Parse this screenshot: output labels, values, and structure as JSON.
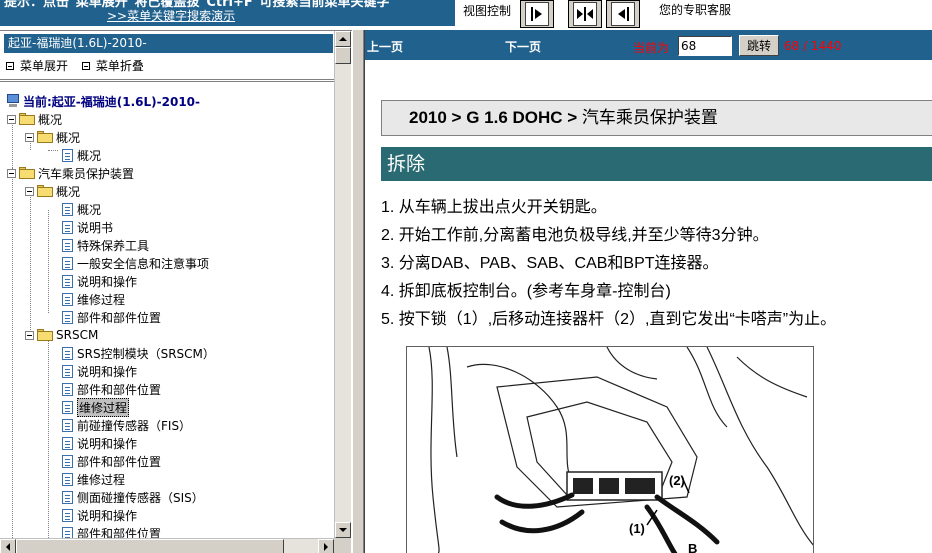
{
  "topbar": {
    "tip_text": "提示：点击\"菜单展开\"将已覆盖拔\"Ctrl+F\"可搜索当前菜单关键字",
    "tip_link": ">>菜单关键字搜索演示",
    "view_control_label": "视图控制",
    "support_text": "您的专职客服",
    "view_buttons": [
      "expand-right",
      "split",
      "expand-left"
    ]
  },
  "left_panel": {
    "model_title": "起亚-福瑞迪(1.6L)-2010-",
    "menu_expand": "菜单展开",
    "menu_collapse": "菜单折叠",
    "tree": {
      "root": "当前:起亚-福瑞迪(1.6L)-2010-",
      "items": [
        {
          "label": "概况",
          "type": "folder",
          "level": 0
        },
        {
          "label": "概况",
          "type": "folder",
          "level": 1
        },
        {
          "label": "概况",
          "type": "page",
          "level": 2
        },
        {
          "label": "汽车乘员保护装置",
          "type": "folder",
          "level": 0
        },
        {
          "label": "概况",
          "type": "folder",
          "level": 1
        },
        {
          "label": "概况",
          "type": "page",
          "level": 2
        },
        {
          "label": "说明书",
          "type": "page",
          "level": 2
        },
        {
          "label": "特殊保养工具",
          "type": "page",
          "level": 2
        },
        {
          "label": "一般安全信息和注意事项",
          "type": "page",
          "level": 2
        },
        {
          "label": "说明和操作",
          "type": "page",
          "level": 2
        },
        {
          "label": "维修过程",
          "type": "page",
          "level": 2
        },
        {
          "label": "部件和部件位置",
          "type": "page",
          "level": 2
        },
        {
          "label": "SRSCM",
          "type": "folder",
          "level": 1
        },
        {
          "label": "SRS控制模块（SRSCM）",
          "type": "page",
          "level": 2
        },
        {
          "label": "说明和操作",
          "type": "page",
          "level": 2
        },
        {
          "label": "部件和部件位置",
          "type": "page",
          "level": 2
        },
        {
          "label": "维修过程",
          "type": "page",
          "level": 2,
          "selected": true
        },
        {
          "label": "前碰撞传感器（FIS）",
          "type": "page",
          "level": 2
        },
        {
          "label": "说明和操作",
          "type": "page",
          "level": 2
        },
        {
          "label": "部件和部件位置",
          "type": "page",
          "level": 2
        },
        {
          "label": "维修过程",
          "type": "page",
          "level": 2
        },
        {
          "label": "侧面碰撞传感器（SIS）",
          "type": "page",
          "level": 2
        },
        {
          "label": "说明和操作",
          "type": "page",
          "level": 2
        },
        {
          "label": "部件和部件位置",
          "type": "page",
          "level": 2
        }
      ]
    }
  },
  "right_panel": {
    "nav": {
      "prev": "上一页",
      "next": "下一页",
      "current_label": "当前为",
      "page_value": "68",
      "jump_button": "跳转",
      "page_count": "68 / 1440"
    },
    "breadcrumb": {
      "bold": "2010 > G 1.6 DOHC >",
      "rest": " 汽车乘员保护装置"
    },
    "section_title": "拆除",
    "steps": [
      "1. 从车辆上拔出点火开关钥匙。",
      "2. 开始工作前,分离蓄电池负极导线,并至少等待3分钟。",
      "3. 分离DAB、PAB、SAB、CAB和BPT连接器。",
      "4. 拆卸底板控制台。(参考车身章-控制台)",
      "5. 按下锁（1）,后移动连接器杆（2）,直到它发出“卡嗒声”为止。"
    ],
    "figure_labels": [
      "(2)",
      "(1)",
      "B"
    ]
  },
  "colors": {
    "header_blue": "#21618d",
    "section_teal": "#2a6b73",
    "nav_red": "#ff0000",
    "root_navy": "#000080"
  }
}
